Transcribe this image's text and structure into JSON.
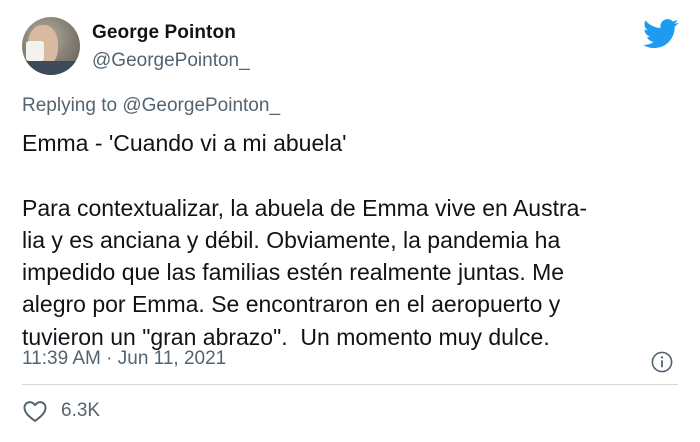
{
  "author": {
    "name": "George Pointon",
    "handle": "@GeorgePointon_"
  },
  "reply": {
    "prefix": "Replying to ",
    "to": "@GeorgePointon_"
  },
  "tweet": {
    "lines": [
      "Emma - 'Cuando vi a mi abuela'",
      "",
      "Para contextualizar, la abuela de Emma vive en Austra-",
      "lia y es anciana y débil. Obviamente, la pandemia ha",
      "impedido que las familias estén realmente juntas. Me",
      "alegro por Emma. Se encontraron en el aeropuerto y",
      "tuvieron un \"gran abrazo\".  Un momento muy dulce."
    ],
    "timestamp": "11:39 AM · Jun 11, 2021"
  },
  "engagement": {
    "likes": "6.3K"
  },
  "icons": {
    "brand": "twitter-bird-icon",
    "info": "info-icon",
    "like": "heart-icon"
  },
  "colors": {
    "brand": "#1d9bf0",
    "text": "#0f1419",
    "muted": "#536471",
    "divider": "#cfd9de"
  }
}
